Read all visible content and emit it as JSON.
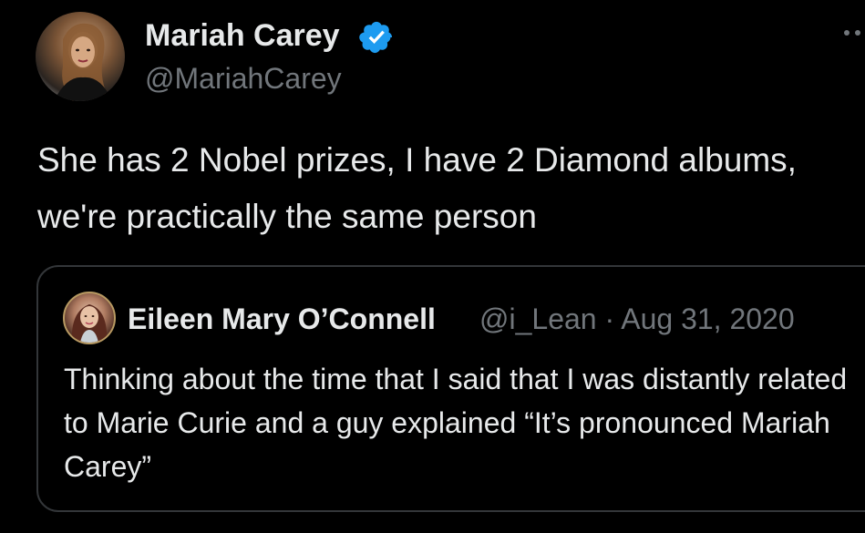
{
  "tweet": {
    "author": {
      "display_name": "Mariah Carey",
      "handle": "@MariahCarey",
      "verified_icon": "verified-badge-icon",
      "avatar_icon": "profile-photo"
    },
    "text": "She has 2 Nobel prizes, I have 2 Diamond albums, we're practically the same person",
    "more_icon": "more-options-icon"
  },
  "quoted_tweet": {
    "author": {
      "display_name": "Eileen Mary O’Connell",
      "handle": "@i_Lean",
      "avatar_icon": "profile-photo"
    },
    "separator": "·",
    "date": "Aug 31, 2020",
    "text": "Thinking about the time that I said that I was distantly related to Marie Curie and a guy explained “It’s pronounced Mariah Carey”"
  },
  "colors": {
    "background": "#000000",
    "primary_text": "#e7e9ea",
    "secondary_text": "#71767b",
    "verified_blue": "#1d9bf0",
    "card_border": "#333639"
  }
}
